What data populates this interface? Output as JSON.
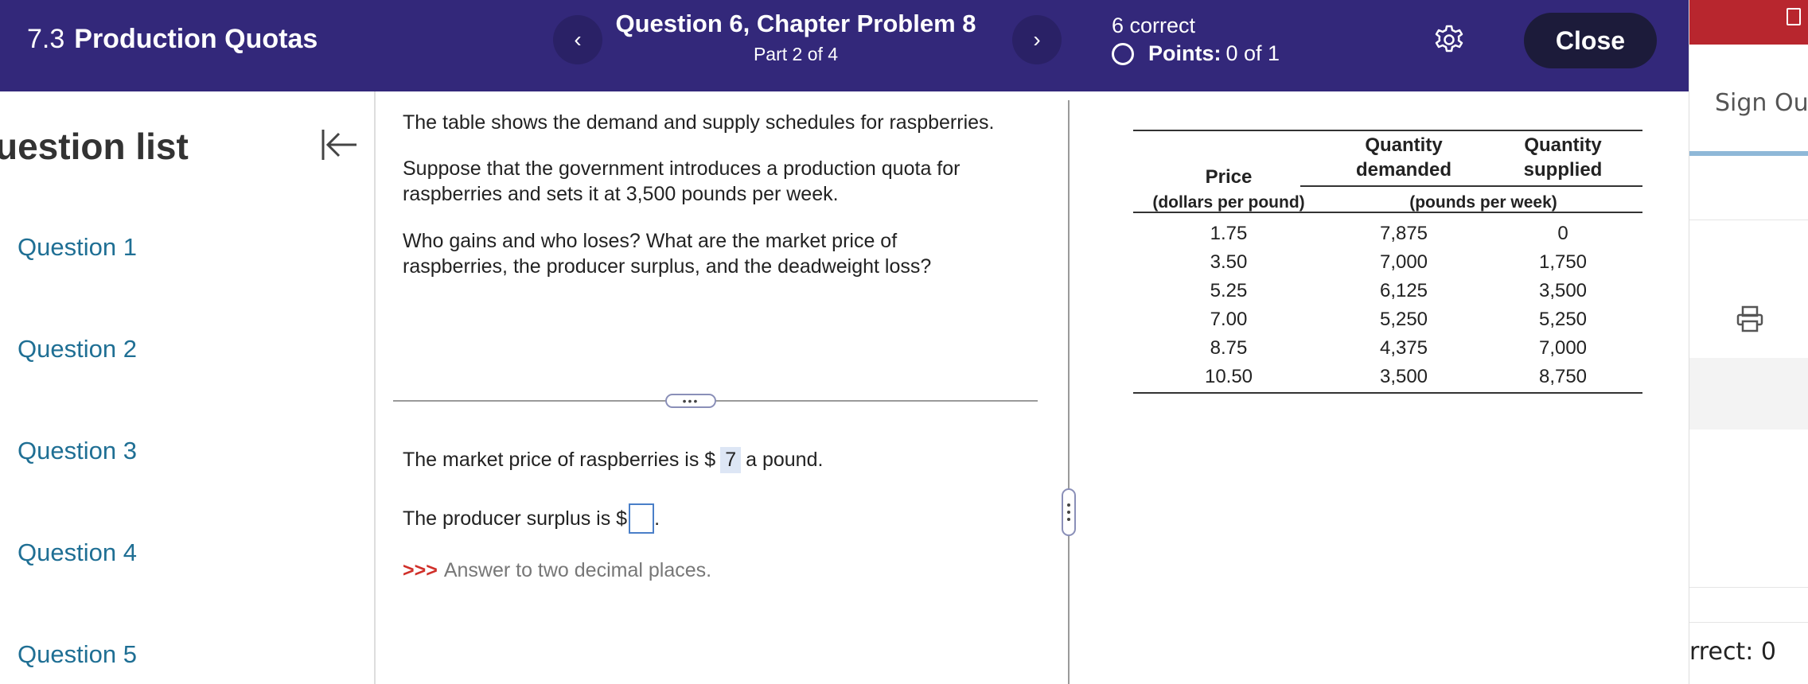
{
  "header": {
    "section_number": "7.3",
    "section_title": "Production Quotas",
    "question_title": "Question 6, Chapter Problem 8",
    "question_part": "Part 2 of 4",
    "correct_text": "6 correct",
    "points_label": "Points:",
    "points_value": "0 of 1",
    "prev_symbol": "‹",
    "next_symbol": "›",
    "close_label": "Close",
    "colors": {
      "bar": "#33287a",
      "close_button": "#1c1b3a"
    }
  },
  "sidebar": {
    "title": "uestion list",
    "questions": [
      "Question 1",
      "Question 2",
      "Question 3",
      "Question 4",
      "Question 5"
    ],
    "link_color": "#1f6f94"
  },
  "question": {
    "intro": "The table shows the demand and supply schedules for raspberries.",
    "scenario": "Suppose that the government introduces a production quota for raspberries and sets it at 3,500 pounds per week.",
    "prompt": "Who gains and who loses? What are the market price of raspberries, the producer  surplus, and the deadweight loss?",
    "more_label": "•••",
    "market_price_prefix": "The market price of raspberries is $",
    "market_price_value": "7",
    "market_price_suffix": "a pound.",
    "producer_surplus_prefix": "The producer surplus is $",
    "producer_surplus_value": "",
    "producer_surplus_suffix": ".",
    "hint_arrows": ">>>",
    "hint_text": "Answer to two decimal places."
  },
  "table": {
    "col1_header": "Price",
    "col1_unit": "(dollars per pound)",
    "col2_header_1": "Quantity",
    "col2_header_2": "demanded",
    "col3_header_1": "Quantity",
    "col3_header_2": "supplied",
    "qty_unit": "(pounds per week)",
    "rows": [
      {
        "price": "1.75",
        "demanded": "7,875",
        "supplied": "0"
      },
      {
        "price": "3.50",
        "demanded": "7,000",
        "supplied": "1,750"
      },
      {
        "price": "5.25",
        "demanded": "6,125",
        "supplied": "3,500"
      },
      {
        "price": "7.00",
        "demanded": "5,250",
        "supplied": "5,250"
      },
      {
        "price": "8.75",
        "demanded": "4,375",
        "supplied": "7,000"
      },
      {
        "price": "10.50",
        "demanded": "3,500",
        "supplied": "8,750"
      }
    ]
  },
  "right_panel": {
    "sign_out": "Sign Out",
    "correct_count": "rrect: 0"
  },
  "icons": {
    "settings": "gear-icon",
    "collapse": "collapse-left-icon",
    "print": "printer-icon"
  }
}
